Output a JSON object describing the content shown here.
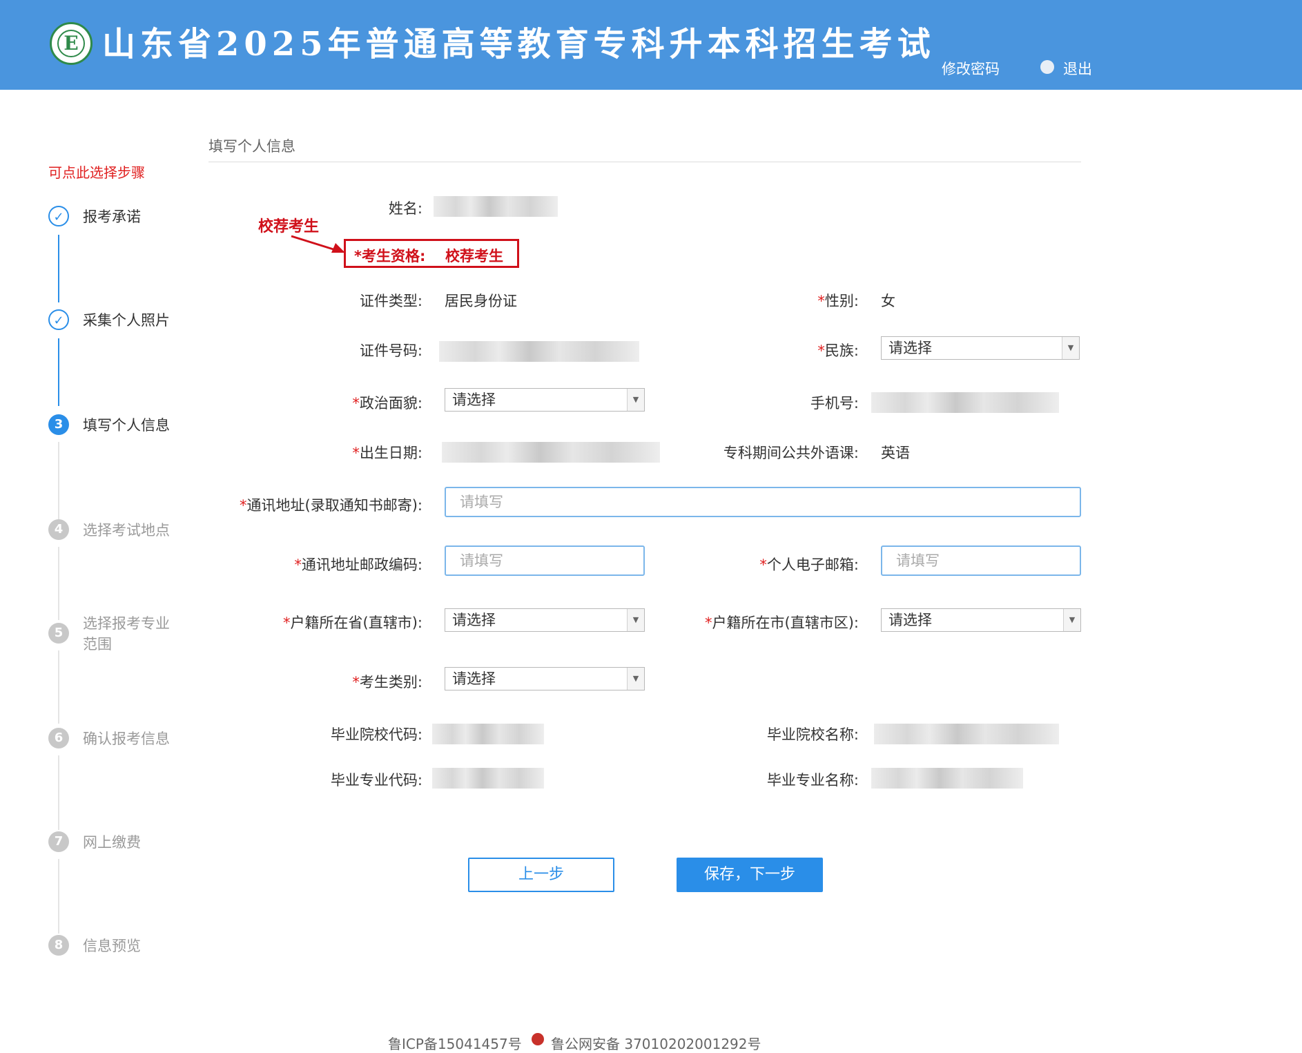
{
  "header": {
    "logo_letter": "E",
    "title": "山东省2025年普通高等教育专科升本科招生考试",
    "change_password": "修改密码",
    "logout": "退出"
  },
  "sidebar": {
    "tip": "可点此选择步骤",
    "steps": [
      {
        "num": "✓",
        "label": "报考承诺"
      },
      {
        "num": "✓",
        "label": "采集个人照片"
      },
      {
        "num": "3",
        "label": "填写个人信息"
      },
      {
        "num": "4",
        "label": "选择考试地点"
      },
      {
        "num": "5",
        "label": "选择报考专业范围"
      },
      {
        "num": "6",
        "label": "确认报考信息"
      },
      {
        "num": "7",
        "label": "网上缴费"
      },
      {
        "num": "8",
        "label": "信息预览"
      }
    ]
  },
  "section_title": "填写个人信息",
  "annotation": {
    "text": "校荐考生",
    "label": "*考生资格:",
    "value": "校荐考生"
  },
  "form": {
    "name_label": "姓名:",
    "id_type_label": "证件类型:",
    "id_type_value": "居民身份证",
    "gender_label": "性别:",
    "gender_value": "女",
    "id_number_label": "证件号码:",
    "ethnicity_label": "民族:",
    "political_label": "政治面貌:",
    "phone_label": "手机号:",
    "birth_label": "出生日期:",
    "foreign_lang_label": "专科期间公共外语课:",
    "foreign_lang_value": "英语",
    "address_label": "通讯地址(录取通知书邮寄):",
    "postcode_label": "通讯地址邮政编码:",
    "email_label": "个人电子邮箱:",
    "province_label": "户籍所在省(直辖市):",
    "city_label": "户籍所在市(直辖市区):",
    "category_label": "考生类别:",
    "school_code_label": "毕业院校代码:",
    "school_name_label": "毕业院校名称:",
    "major_code_label": "毕业专业代码:",
    "major_name_label": "毕业专业名称:",
    "select_placeholder": "请选择",
    "input_placeholder": "请填写",
    "required_mark": "*"
  },
  "buttons": {
    "prev": "上一步",
    "next": "保存，下一步"
  },
  "footer": {
    "icp": "鲁ICP备15041457号",
    "police": "鲁公网安备 37010202001292号"
  }
}
